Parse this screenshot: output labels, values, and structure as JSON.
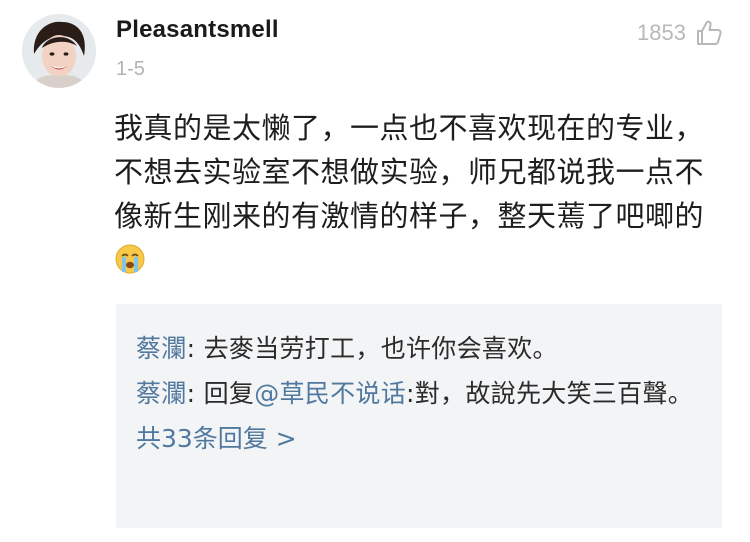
{
  "comment": {
    "username": "Pleasantsmell",
    "date": "1-5",
    "likes": "1853",
    "like_icon": "thumbs-up-icon",
    "text": "我真的是太懒了，一点也不喜欢现在的专业，不想去实验室不想做实验，师兄都说我一点不像新生刚来的有激情的样子，整天蔫了吧唧的",
    "emoji": "crying-face-emoji"
  },
  "replies": {
    "items": [
      {
        "author": "蔡瀾",
        "separator": ": ",
        "text": "去麥当劳打工，也许你会喜欢。"
      },
      {
        "author": "蔡瀾",
        "separator": ": ",
        "prefix": "回复",
        "mention": "@草民不说话",
        "text": ":對，故說先大笑三百聲。"
      }
    ],
    "more_label": "共33条回复 >"
  },
  "colors": {
    "link": "#51799f",
    "reply_bg": "#f3f4f6",
    "muted": "#b3b3b3"
  }
}
